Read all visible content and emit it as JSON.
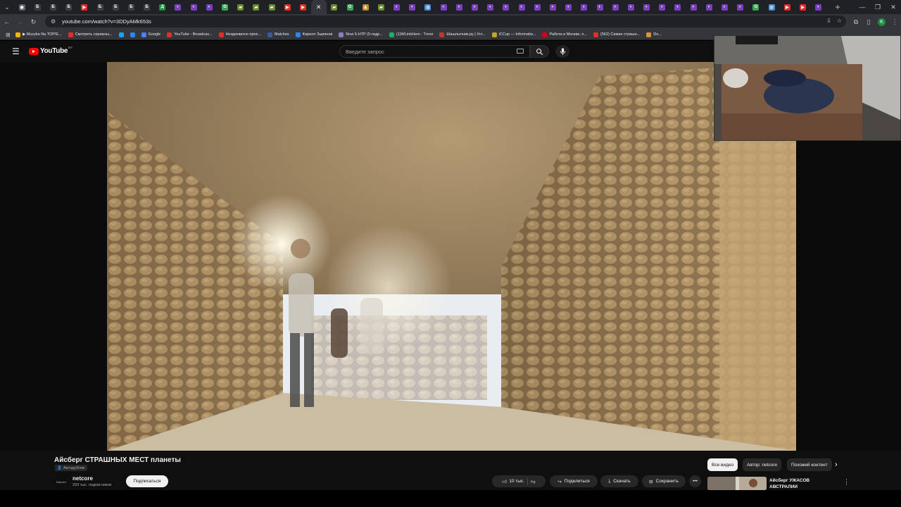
{
  "browser": {
    "tab_favicons": [
      {
        "color": "#5f6368",
        "glyph": "◉"
      },
      {
        "color": "#3c4043",
        "glyph": "Б"
      },
      {
        "color": "#3c4043",
        "glyph": "Б"
      },
      {
        "color": "#3c4043",
        "glyph": "Б"
      },
      {
        "color": "#e52d27",
        "glyph": "▶"
      },
      {
        "color": "#3c4043",
        "glyph": "Б"
      },
      {
        "color": "#3c4043",
        "glyph": "Б"
      },
      {
        "color": "#3c4043",
        "glyph": "Б"
      },
      {
        "color": "#3c4043",
        "glyph": "Б"
      },
      {
        "color": "#1e8e3e",
        "glyph": "Д"
      },
      {
        "color": "#7b3fc4",
        "glyph": "◐"
      },
      {
        "color": "#7b3fc4",
        "glyph": "◐"
      },
      {
        "color": "#7b3fc4",
        "glyph": "◐"
      },
      {
        "color": "#34a853",
        "glyph": "G"
      },
      {
        "color": "#6e8a2e",
        "glyph": "▰"
      },
      {
        "color": "#6e8a2e",
        "glyph": "▰"
      },
      {
        "color": "#6e8a2e",
        "glyph": "▰"
      },
      {
        "color": "#e52d27",
        "glyph": "▶"
      },
      {
        "color": "#e52d27",
        "glyph": "▶"
      },
      {
        "color": "#35363a",
        "glyph": ""
      },
      {
        "color": "#6e8a2e",
        "glyph": "▰"
      },
      {
        "color": "#34a853",
        "glyph": "G"
      },
      {
        "color": "#c48a2a",
        "glyph": "♟"
      },
      {
        "color": "#6e8a2e",
        "glyph": "▰"
      },
      {
        "color": "#7b3fc4",
        "glyph": "◐"
      },
      {
        "color": "#7b3fc4",
        "glyph": "◐"
      },
      {
        "color": "#4a90d9",
        "glyph": "◎"
      },
      {
        "color": "#7b3fc4",
        "glyph": "◐"
      },
      {
        "color": "#7b3fc4",
        "glyph": "◐"
      },
      {
        "color": "#7b3fc4",
        "glyph": "◐"
      },
      {
        "color": "#7b3fc4",
        "glyph": "◐"
      },
      {
        "color": "#7b3fc4",
        "glyph": "◐"
      },
      {
        "color": "#7b3fc4",
        "glyph": "◐"
      },
      {
        "color": "#7b3fc4",
        "glyph": "◐"
      },
      {
        "color": "#7b3fc4",
        "glyph": "◐"
      },
      {
        "color": "#7b3fc4",
        "glyph": "◐"
      },
      {
        "color": "#7b3fc4",
        "glyph": "◐"
      },
      {
        "color": "#7b3fc4",
        "glyph": "◐"
      },
      {
        "color": "#7b3fc4",
        "glyph": "◐"
      },
      {
        "color": "#7b3fc4",
        "glyph": "◐"
      },
      {
        "color": "#7b3fc4",
        "glyph": "◐"
      },
      {
        "color": "#7b3fc4",
        "glyph": "◐"
      },
      {
        "color": "#7b3fc4",
        "glyph": "◐"
      },
      {
        "color": "#7b3fc4",
        "glyph": "◐"
      },
      {
        "color": "#7b3fc4",
        "glyph": "◐"
      },
      {
        "color": "#7b3fc4",
        "glyph": "◐"
      },
      {
        "color": "#7b3fc4",
        "glyph": "◐"
      },
      {
        "color": "#34a853",
        "glyph": "G"
      },
      {
        "color": "#4a90d9",
        "glyph": "◎"
      },
      {
        "color": "#e52d27",
        "glyph": "▶"
      },
      {
        "color": "#e52d27",
        "glyph": "▶"
      },
      {
        "color": "#7b3fc4",
        "glyph": "◐"
      }
    ],
    "active_tab_index": 19,
    "new_tab_label": "+",
    "address": "youtube.com/watch?v=3DDyAMk653s",
    "profile_initial": "K",
    "bookmarks": [
      {
        "label": "▶ Muzyka Na TOP!E...",
        "color": "#f4b400"
      },
      {
        "label": "Смотреть сериалы...",
        "color": "#e52d27"
      },
      {
        "label": "",
        "color": "#1da1f2"
      },
      {
        "label": "",
        "color": "#2787f5"
      },
      {
        "label": "Google",
        "color": "#4285f4"
      },
      {
        "label": "YouTube - Broadcas...",
        "color": "#e52d27"
      },
      {
        "label": "Нездекватно прох...",
        "color": "#e52d27"
      },
      {
        "label": "Matches",
        "color": "#3b5998"
      },
      {
        "label": "Кирилл Зырянов",
        "color": "#2787f5"
      },
      {
        "label": "Now 5-HTP (5-гидр...",
        "color": "#8e7cc3"
      },
      {
        "label": "(1)WLinkHero - Trovo",
        "color": "#19b26b"
      },
      {
        "label": "Шашлычник.ру | Уст...",
        "color": "#c0392b"
      },
      {
        "label": "iCCup — Informatio...",
        "color": "#c9a227"
      },
      {
        "label": "Работа в Москве, п...",
        "color": "#d0021b"
      },
      {
        "label": "(562) Самая страшн...",
        "color": "#e52d27"
      },
      {
        "label": "Do...",
        "color": "#e08e3c"
      }
    ]
  },
  "youtube": {
    "logo_text": "YouTube",
    "logo_region": "BY",
    "search_placeholder": "Введите запрос"
  },
  "video": {
    "title": "Айсберг СТРАШНЫХ МЕСТ планеты",
    "dub_badge": "Автодубляж",
    "channel_name": "netcore",
    "channel_avatar_text": "Netcore",
    "subscribers": "293 тыс. подписчиков",
    "subscribe_label": "Подписаться",
    "likes": "10 тыс.",
    "share_label": "Поделиться",
    "download_label": "Скачать",
    "save_label": "Сохранить"
  },
  "chips": [
    "Все видео",
    "Автор: netcore",
    "Похожий контент"
  ],
  "recommendation": {
    "title": "Айсберг УЖАСОВ АВСТРАЛИИ"
  }
}
